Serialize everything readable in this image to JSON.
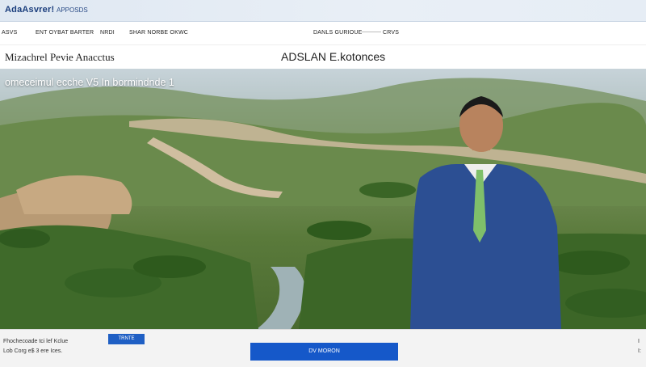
{
  "brand": {
    "logo": "AdaAsvrer!",
    "sub": "APPOSDS"
  },
  "nav": {
    "items": [
      "ASVS",
      "ENT OYBAT BARTER",
      "NRDI",
      "SHAR NORBE OKWC",
      "DANLS GURIOUE",
      "CRVS"
    ]
  },
  "titles": {
    "left": "Mizachrel Pevie Anacctus",
    "center": "ADSLAN E.kotonces"
  },
  "hero": {
    "caption": "omeceimul ecche V5 In bormindnde 1"
  },
  "footer": {
    "line1": "Fhochecoade tci lef Kclue",
    "line2": "Lob Corg e$ 3 ere Ices.",
    "small_button": "TRNTE",
    "main_button": "DV MORON",
    "right1": "I",
    "right2": "I:"
  },
  "colors": {
    "accent": "#1558c9",
    "brand": "#1a3d7c"
  }
}
